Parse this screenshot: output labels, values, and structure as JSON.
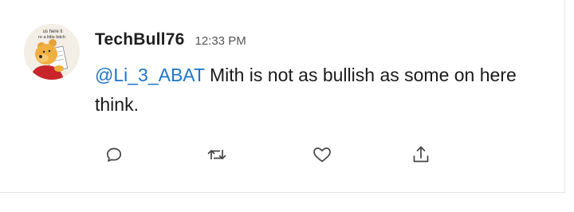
{
  "post": {
    "author": "TechBull76",
    "time": "12:33 PM",
    "mention": "@Li_3_ABAT",
    "body_after_mention": " Mith is not as bullish as some on here think.",
    "avatar": {
      "caption_line1": "us here it",
      "caption_line2": "re a little bitch"
    }
  },
  "actions": [
    {
      "icon": "reply-icon"
    },
    {
      "icon": "retweet-icon"
    },
    {
      "icon": "like-icon"
    },
    {
      "icon": "share-icon"
    }
  ],
  "colors": {
    "mention": "#1d75c8",
    "icon": "#444444",
    "text": "#1a1a1a"
  }
}
